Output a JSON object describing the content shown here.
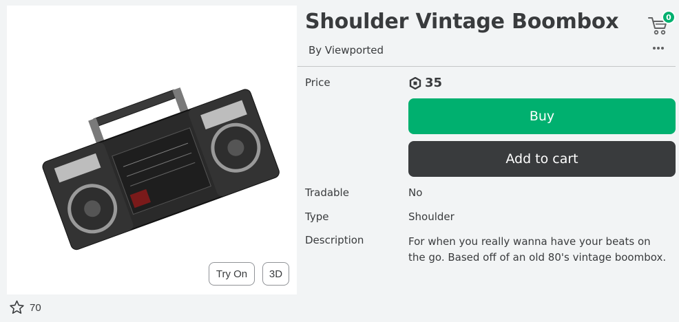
{
  "item": {
    "title": "Shoulder Vintage Boombox",
    "creator": "By Viewported",
    "favorites": "70"
  },
  "thumbnail": {
    "try_on_label": "Try On",
    "three_d_label": "3D",
    "image_icon": "boombox-thumbnail"
  },
  "cart": {
    "count": "0",
    "icon": "cart-icon"
  },
  "details": {
    "price_label": "Price",
    "price_value": "35",
    "currency_icon": "robux-icon",
    "buy_label": "Buy",
    "add_to_cart_label": "Add to cart",
    "tradable_label": "Tradable",
    "tradable_value": "No",
    "type_label": "Type",
    "type_value": "Shoulder",
    "description_label": "Description",
    "description_value": "For when you really wanna have your beats on the go. Based off of an old 80's vintage boombox."
  },
  "colors": {
    "buy": "#00b06f",
    "add_to_cart": "#393b3d",
    "background": "#f2f4f5",
    "text": "#393b3d"
  }
}
